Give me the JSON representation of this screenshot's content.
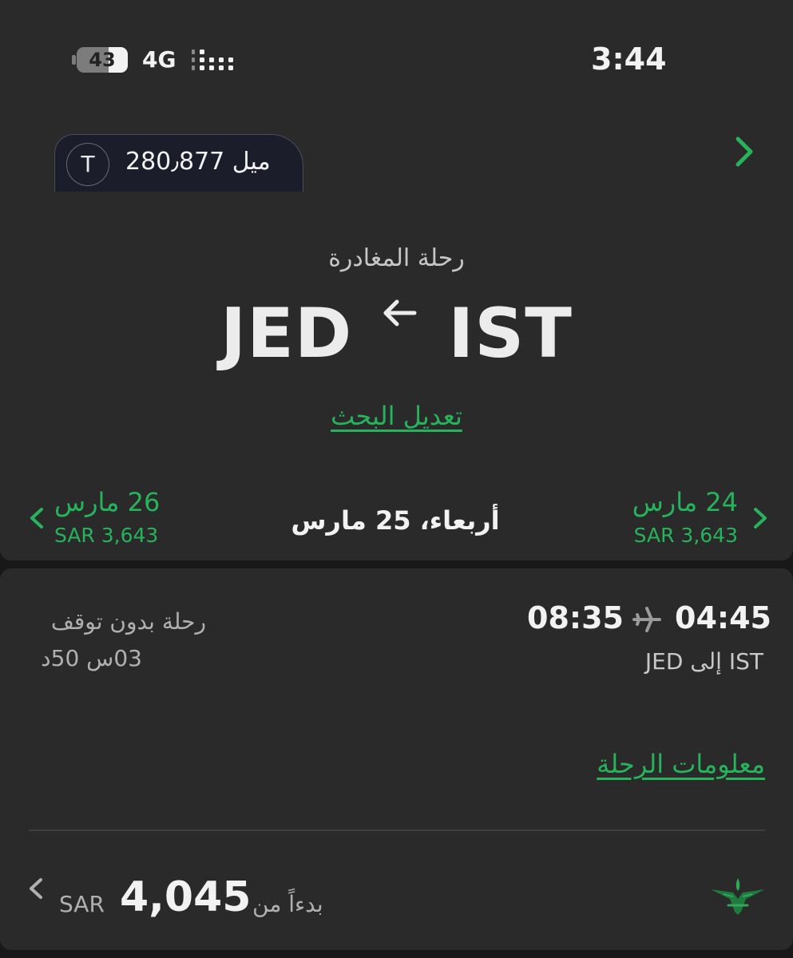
{
  "status_bar": {
    "battery": "43",
    "network": "4G",
    "time": "3:44"
  },
  "header": {
    "avatar_initial": "T",
    "miles": "ميل 280٫877"
  },
  "trip": {
    "title": "رحلة المغادرة",
    "origin": "IST",
    "destination": "JED",
    "modify_search": "تعديل البحث"
  },
  "date_selector": {
    "previous": {
      "date": "24 مارس",
      "price": "SAR 3,643"
    },
    "current": "أربعاء، 25 مارس",
    "next": {
      "date": "26 مارس",
      "price": "SAR 3,643"
    }
  },
  "flight": {
    "departure_time": "04:45",
    "arrival_time": "08:35",
    "route": "IST إلى JED",
    "stops": "رحلة بدون توقف",
    "duration": "03س 50د",
    "info_link": "معلومات الرحلة",
    "price_prefix": "بدءاً من",
    "price_amount": "4,045",
    "price_currency": "SAR"
  },
  "icons": {
    "accent": "#27b35c",
    "nav_next": "chevron-right-icon",
    "route_arrow": "arrow-left-icon",
    "plane": "airplane-icon",
    "airline_logo": "saudia-logo-icon"
  }
}
